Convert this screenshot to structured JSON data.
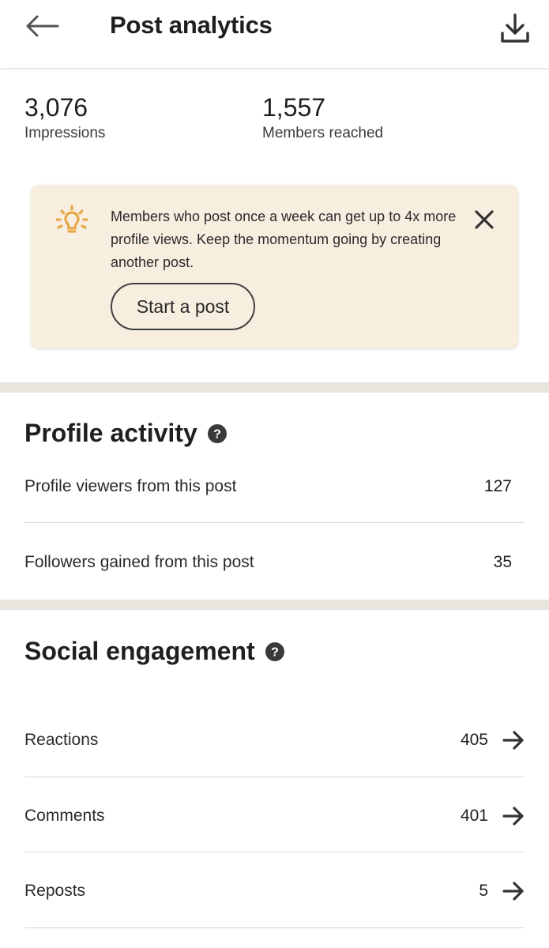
{
  "header": {
    "title": "Post analytics",
    "back_icon": "arrow-left-icon",
    "download_icon": "download-icon"
  },
  "stats": [
    {
      "value": "3,076",
      "label": "Impressions"
    },
    {
      "value": "1,557",
      "label": "Members reached"
    }
  ],
  "tip": {
    "icon": "lightbulb-icon",
    "message": "Members who post once a week can get up to 4x more profile views. Keep the momentum going by creating another post.",
    "button_label": "Start a post",
    "close_icon": "close-icon",
    "accent_color": "#e7a33e",
    "background_color": "#f8eee0"
  },
  "profile_activity": {
    "title": "Profile activity",
    "help_icon": "help-icon",
    "rows": [
      {
        "label": "Profile viewers from this post",
        "value": "127"
      },
      {
        "label": "Followers gained from this post",
        "value": "35"
      }
    ]
  },
  "social_engagement": {
    "title": "Social engagement",
    "help_icon": "help-icon",
    "rows": [
      {
        "label": "Reactions",
        "value": "405",
        "icon": "arrow-right-icon"
      },
      {
        "label": "Comments",
        "value": "401",
        "icon": "arrow-right-icon"
      },
      {
        "label": "Reposts",
        "value": "5",
        "icon": "arrow-right-icon"
      }
    ]
  }
}
